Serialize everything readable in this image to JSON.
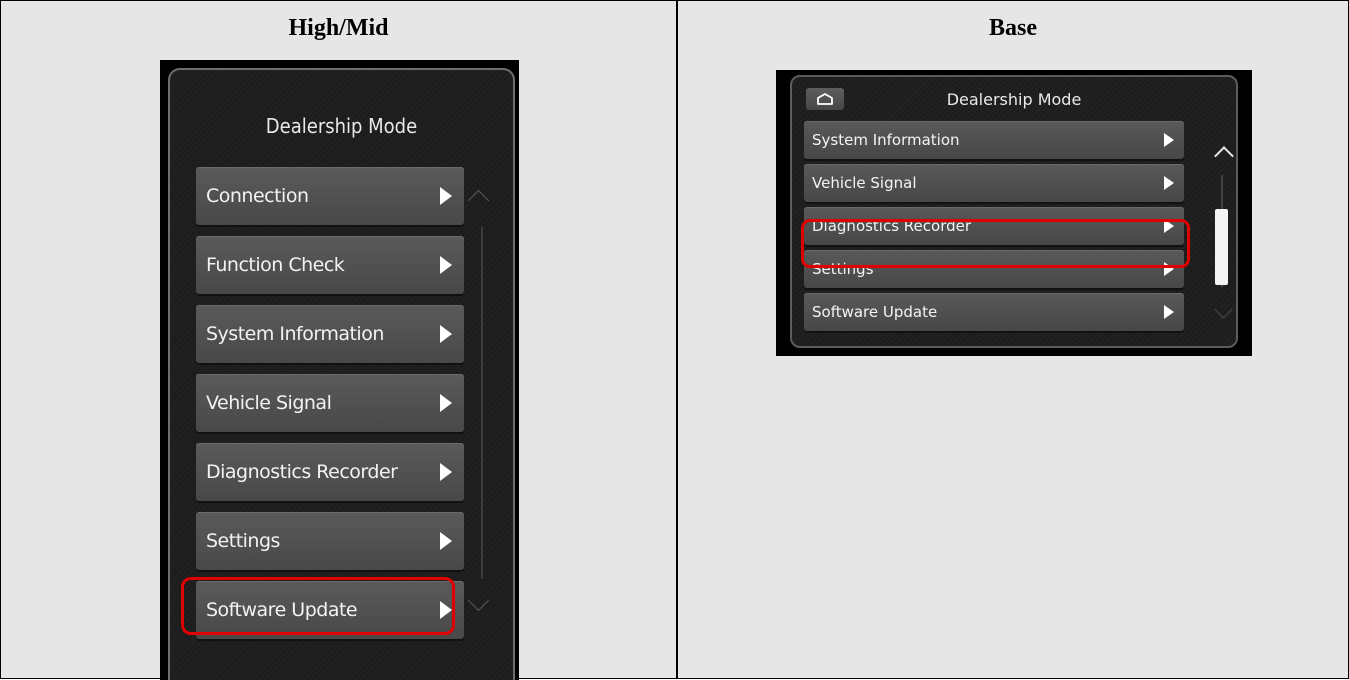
{
  "columns": {
    "left_header": "High/Mid",
    "right_header": "Base"
  },
  "high_mid": {
    "title": "Dealership Mode",
    "items": [
      {
        "label": "Connection"
      },
      {
        "label": "Function Check"
      },
      {
        "label": "System Information"
      },
      {
        "label": "Vehicle Signal"
      },
      {
        "label": "Diagnostics Recorder"
      },
      {
        "label": "Settings"
      },
      {
        "label": "Software Update"
      }
    ],
    "highlighted_item": "Software Update"
  },
  "base": {
    "title": "Dealership Mode",
    "home_icon": "home-icon",
    "items": [
      {
        "label": "System Information"
      },
      {
        "label": "Vehicle Signal"
      },
      {
        "label": "Diagnostics Recorder"
      },
      {
        "label": "Settings"
      },
      {
        "label": "Software Update"
      }
    ],
    "highlighted_item": "Software Update"
  },
  "colors": {
    "highlight": "#e00000",
    "button": "#4f4f4f",
    "screen_bg": "#1c1c1c",
    "cell_bg": "#e6e6e6"
  }
}
